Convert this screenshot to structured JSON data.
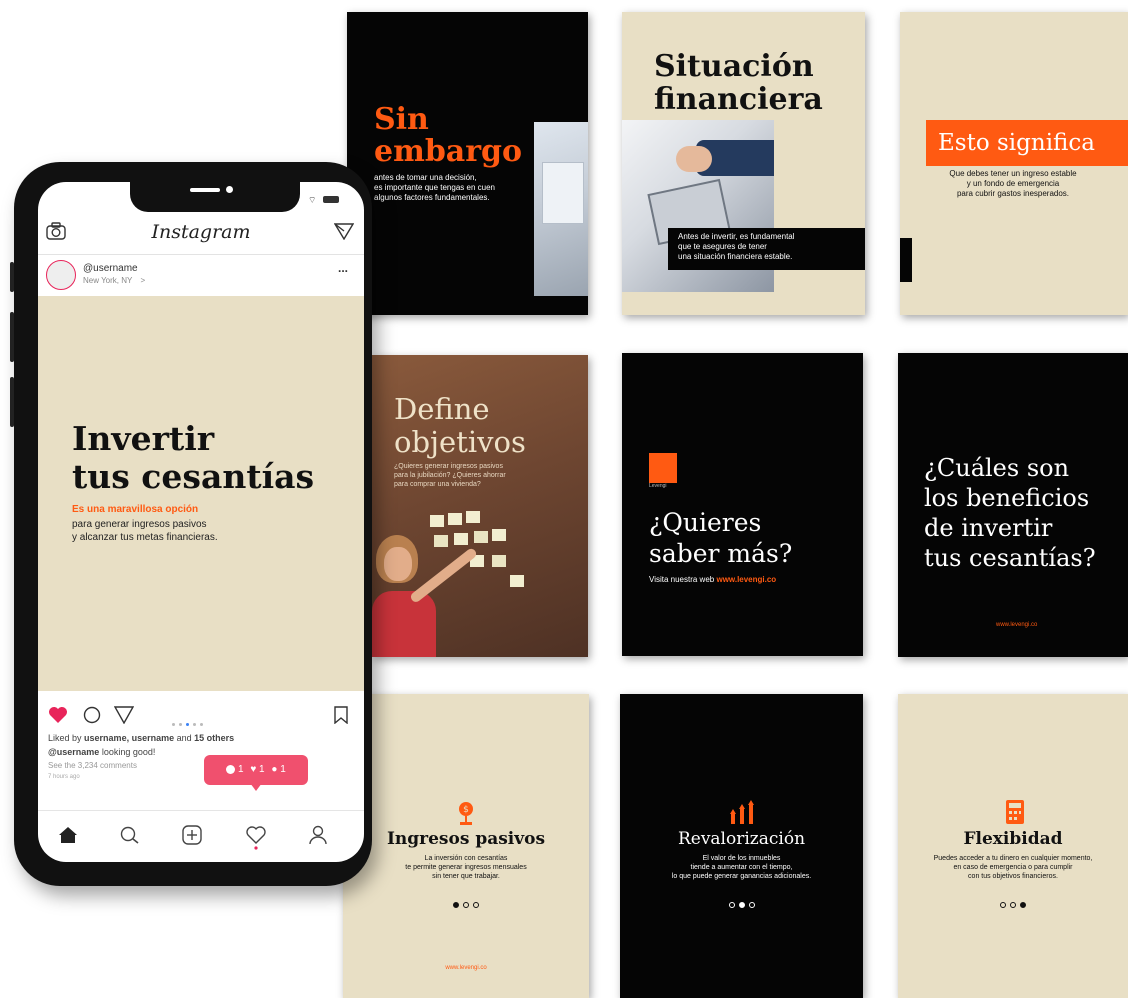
{
  "phone": {
    "app_title": "Instagram",
    "username": "@username",
    "location": "New York, NY",
    "location_arrow": ">",
    "more": "...",
    "post": {
      "title_line1": "Invertir",
      "title_line2": "tus cesantías",
      "highlight": "Es una maravillosa opción",
      "body_line1": "para generar ingresos pasivos",
      "body_line2": "y alcanzar tus metas financieras."
    },
    "liked_by_prefix": "Liked by",
    "liked_by_users": "username, username",
    "liked_by_and": "and",
    "liked_by_others": "15 others",
    "caption_user": "@username",
    "caption_text": "looking good!",
    "comments": "See the 3,234 comments",
    "time": "7 hours ago",
    "notification": {
      "comments": "1",
      "likes": "1",
      "followers": "1"
    },
    "colors": {
      "heart": "#e8245a",
      "badge": "#f0506e"
    }
  },
  "cards": {
    "sin_embargo": {
      "title_line1": "Sin",
      "title_line2": "embargo",
      "body_line1": "antes de tomar una decisión,",
      "body_line2": "es importante que tengas en cuen",
      "body_line3": "algunos factores fundamentales."
    },
    "situacion": {
      "title_line1": "Situación",
      "title_line2": "financiera",
      "body_line1": "Antes de invertir, es fundamental",
      "body_line2": "que te asegures de tener",
      "body_line3": "una situación financiera estable."
    },
    "esto": {
      "title": "Esto significa",
      "body_line1": "Que debes tener un ingreso estable",
      "body_line2": "y un fondo de emergencia",
      "body_line3": "para cubrir gastos inesperados."
    },
    "define": {
      "title_line1": "Define",
      "title_line2": "objetivos",
      "body_line1": "¿Quieres generar ingresos pasivos",
      "body_line2": "para la jubilación? ¿Quieres ahorrar",
      "body_line3": "para comprar una vivienda?"
    },
    "quieres": {
      "logo_text": "Levengi",
      "title_line1": "¿Quieres",
      "title_line2": "saber más?",
      "visit": "Visita nuestra web",
      "url": "www.levengi.co"
    },
    "cuales": {
      "line1": "¿Cuáles son",
      "line2": "los beneficios",
      "line3": "de invertir",
      "line4": "tus cesantías?",
      "url": "www.levengi.co"
    },
    "ingresos": {
      "title": "Ingresos pasivos",
      "body_line1": "La inversión con cesantías",
      "body_line2": "te permite generar ingresos mensuales",
      "body_line3": "sin tener que trabajar.",
      "url": "www.levengi.co",
      "active_dot": 1
    },
    "revalorizacion": {
      "title": "Revalorización",
      "body_line1": "El valor de los inmuebles",
      "body_line2": "tiende a aumentar con el tiempo,",
      "body_line3": "lo que puede generar ganancias adicionales.",
      "active_dot": 2
    },
    "flexibidad": {
      "title": "Flexibidad",
      "body_line1": "Puedes acceder a tu dinero en cualquier momento,",
      "body_line2": "en caso de emergencia o para cumplir",
      "body_line3": "con tus objetivos financieros.",
      "active_dot": 3
    }
  },
  "colors": {
    "accent": "#ff5a12",
    "beige": "#e8dfc5",
    "dark": "#050505"
  }
}
